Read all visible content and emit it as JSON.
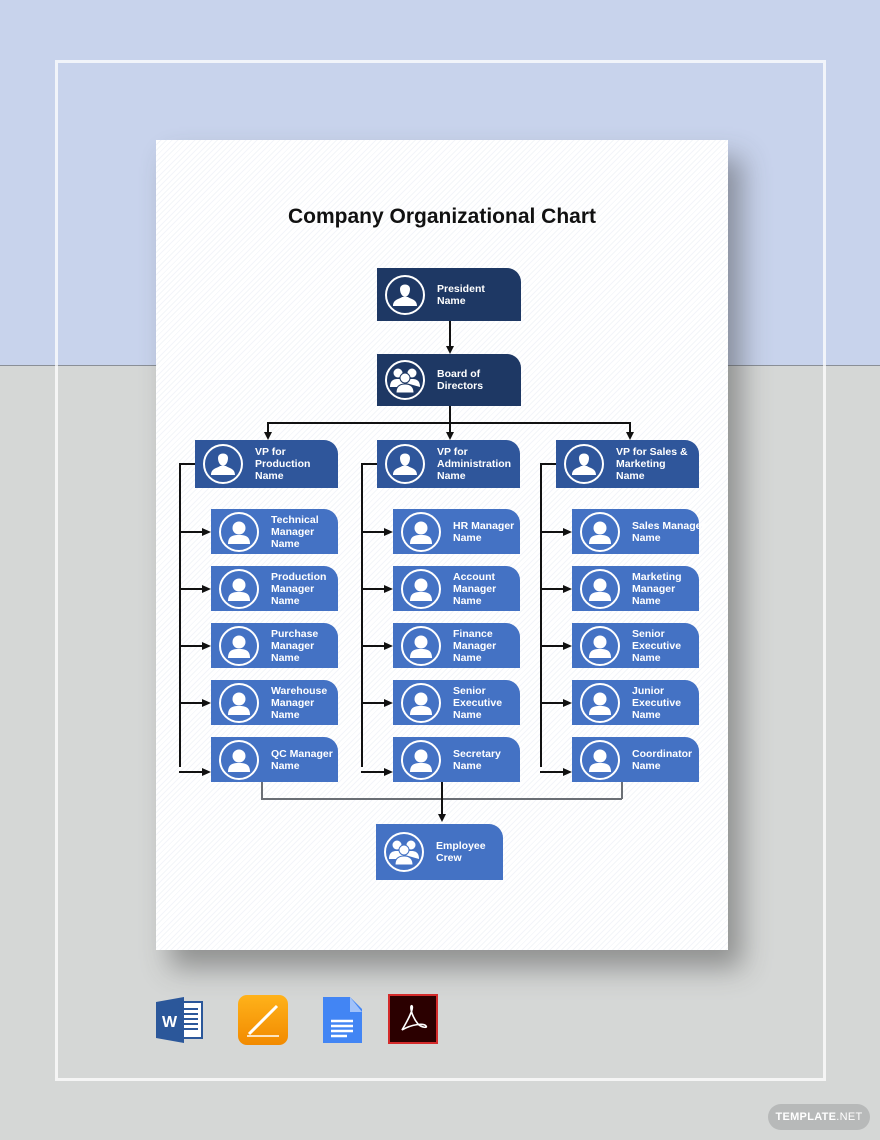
{
  "title": "Company Organizational Chart",
  "colors": {
    "executive": "#1e3864",
    "vp": "#2f569b",
    "manager": "#4472c4",
    "background_top": "#c8d3ec",
    "background_bottom": "#d5d7d6"
  },
  "executive": [
    {
      "line1": "President",
      "line2": "Name",
      "icon": "person-icon"
    },
    {
      "line1": "Board of",
      "line2": "Directors",
      "icon": "group-icon"
    }
  ],
  "columns": [
    {
      "vp": {
        "line1": "VP for",
        "line2": "Production",
        "line3": "Name"
      },
      "reports": [
        {
          "line1": "Technical",
          "line2": "Manager",
          "line3": "Name"
        },
        {
          "line1": "Production",
          "line2": "Manager",
          "line3": "Name"
        },
        {
          "line1": "Purchase",
          "line2": "Manager",
          "line3": "Name"
        },
        {
          "line1": "Warehouse",
          "line2": "Manager",
          "line3": "Name"
        },
        {
          "line1": "QC Manager",
          "line2": "Name",
          "line3": ""
        }
      ]
    },
    {
      "vp": {
        "line1": "VP for",
        "line2": "Administration",
        "line3": "Name"
      },
      "reports": [
        {
          "line1": "HR Manager",
          "line2": "Name",
          "line3": ""
        },
        {
          "line1": "Account",
          "line2": "Manager",
          "line3": "Name"
        },
        {
          "line1": "Finance",
          "line2": "Manager",
          "line3": "Name"
        },
        {
          "line1": "Senior",
          "line2": "Executive",
          "line3": "Name"
        },
        {
          "line1": "Secretary",
          "line2": "Name",
          "line3": ""
        }
      ]
    },
    {
      "vp": {
        "line1": "VP for Sales &",
        "line2": "Marketing",
        "line3": "Name"
      },
      "reports": [
        {
          "line1": "Sales Manager",
          "line2": "Name",
          "line3": ""
        },
        {
          "line1": "Marketing",
          "line2": "Manager",
          "line3": "Name"
        },
        {
          "line1": "Senior",
          "line2": "Executive",
          "line3": "Name"
        },
        {
          "line1": "Junior",
          "line2": "Executive",
          "line3": "Name"
        },
        {
          "line1": "Coordinator",
          "line2": "Name",
          "line3": ""
        }
      ]
    }
  ],
  "crew": {
    "line1": "Employee",
    "line2": "Crew",
    "icon": "group-icon"
  },
  "formats": [
    {
      "name": "Microsoft Word",
      "icon": "word-icon"
    },
    {
      "name": "Apple Pages",
      "icon": "pages-icon"
    },
    {
      "name": "Google Docs",
      "icon": "google-docs-icon"
    },
    {
      "name": "Adobe PDF",
      "icon": "pdf-icon"
    }
  ],
  "watermark": {
    "bold": "TEMPLATE",
    "light": ".NET"
  }
}
